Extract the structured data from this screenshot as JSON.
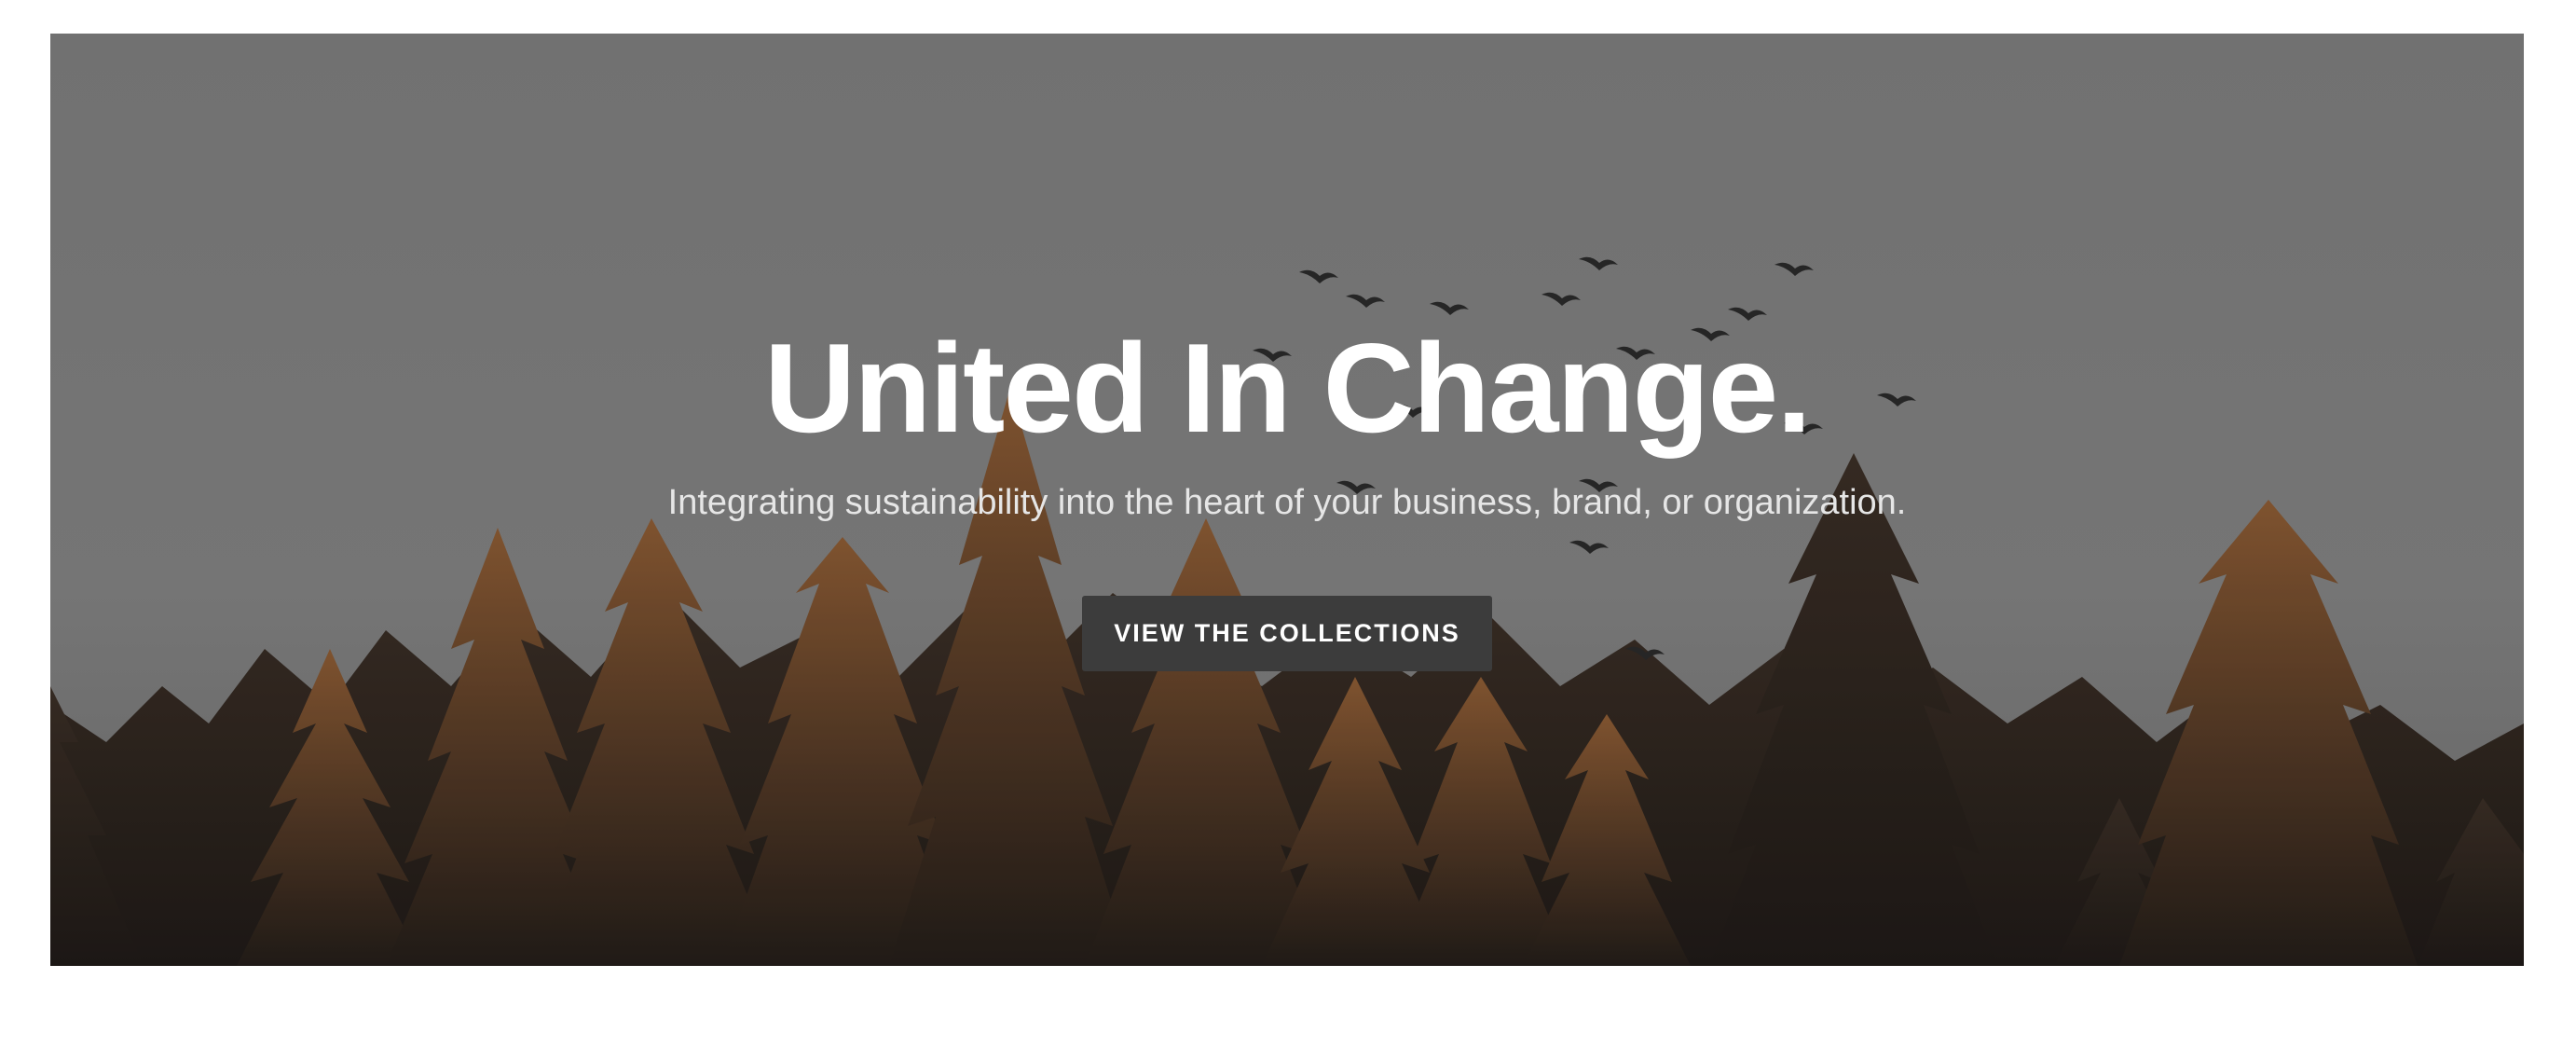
{
  "hero": {
    "title": "United In Change.",
    "subtitle": "Integrating sustainability into the heart of your business, brand, or organization.",
    "cta_label": "VIEW THE COLLECTIONS",
    "background": {
      "subject": "forest-treetops-with-birds",
      "sky_color": "#7d7d7d",
      "tree_dark": "#2a231e",
      "tree_highlight": "#8a5a33"
    },
    "cta_color": "#3c3c3c"
  }
}
